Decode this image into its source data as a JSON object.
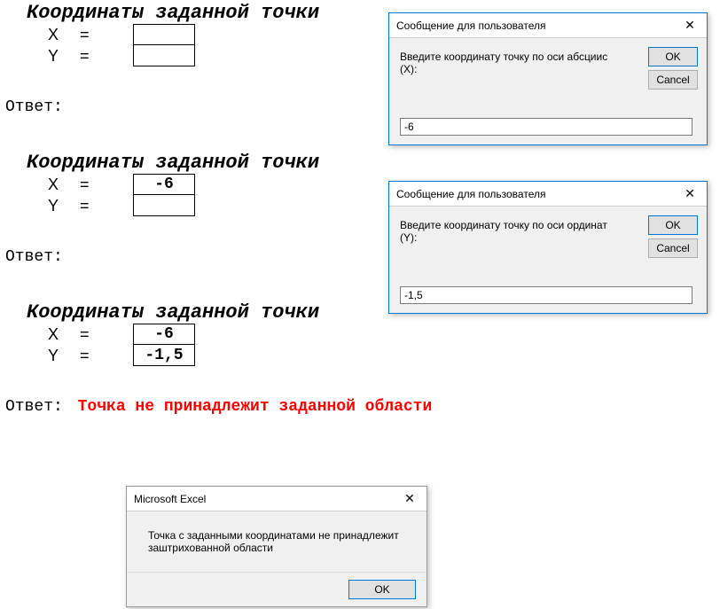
{
  "section1": {
    "header": "Координаты заданной точки",
    "x_label": "X",
    "y_label": "Y",
    "eq": "=",
    "x_value": "",
    "y_value": "",
    "answer_label": "Ответ:"
  },
  "section2": {
    "header": "Координаты заданной точки",
    "x_label": "X",
    "y_label": "Y",
    "eq": "=",
    "x_value": "-6",
    "y_value": "",
    "answer_label": "Ответ:"
  },
  "section3": {
    "header": "Координаты заданной точки",
    "x_label": "X",
    "y_label": "Y",
    "eq": "=",
    "x_value": "-6",
    "y_value": "-1,5",
    "answer_label": "Ответ:",
    "answer_text": "Точка не принадлежит заданной области"
  },
  "dialog1": {
    "title": "Сообщение для пользователя",
    "prompt": "Введите координату точку по оси абсциис (X):",
    "ok_label": "OK",
    "cancel_label": "Cancel",
    "input_value": "-6"
  },
  "dialog2": {
    "title": "Сообщение для пользователя",
    "prompt": "Введите координату точку по оси ординат (Y):",
    "ok_label": "OK",
    "cancel_label": "Cancel",
    "input_value": "-1,5"
  },
  "msgbox": {
    "title": "Microsoft Excel",
    "message": "Точка с заданными координатами не принадлежит заштрихованной области",
    "ok_label": "OK"
  }
}
